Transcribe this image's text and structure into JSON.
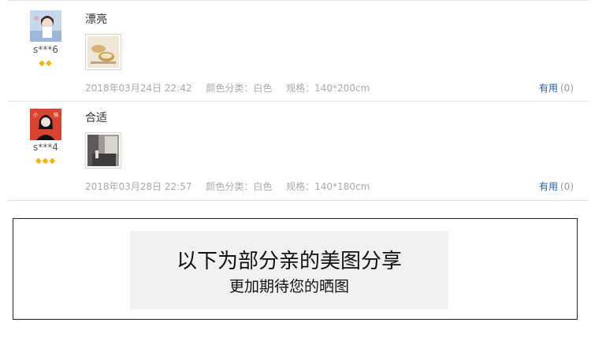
{
  "reviews": [
    {
      "username": "s***6",
      "level_icon": "gem-icon",
      "level_count": 2,
      "content": "漂亮",
      "date": "2018年03月24日 22:42",
      "color_spec": "颜色分类：白色",
      "size_spec": "规格：140*200cm",
      "useful_label": "有用",
      "useful_count": "(0)"
    },
    {
      "username": "s***4",
      "level_icon": "gem-icon",
      "level_count": 3,
      "content": "合适",
      "date": "2018年03月28日 22:57",
      "color_spec": "颜色分类：白色",
      "size_spec": "规格：140*180cm",
      "useful_label": "有用",
      "useful_count": "(0)"
    }
  ],
  "banner": {
    "title": "以下为部分亲的美图分享",
    "subtitle": "更加期待您的晒图"
  },
  "colors": {
    "link": "#225fad",
    "gem": "#f0b400",
    "meta": "#aaaaaa"
  }
}
